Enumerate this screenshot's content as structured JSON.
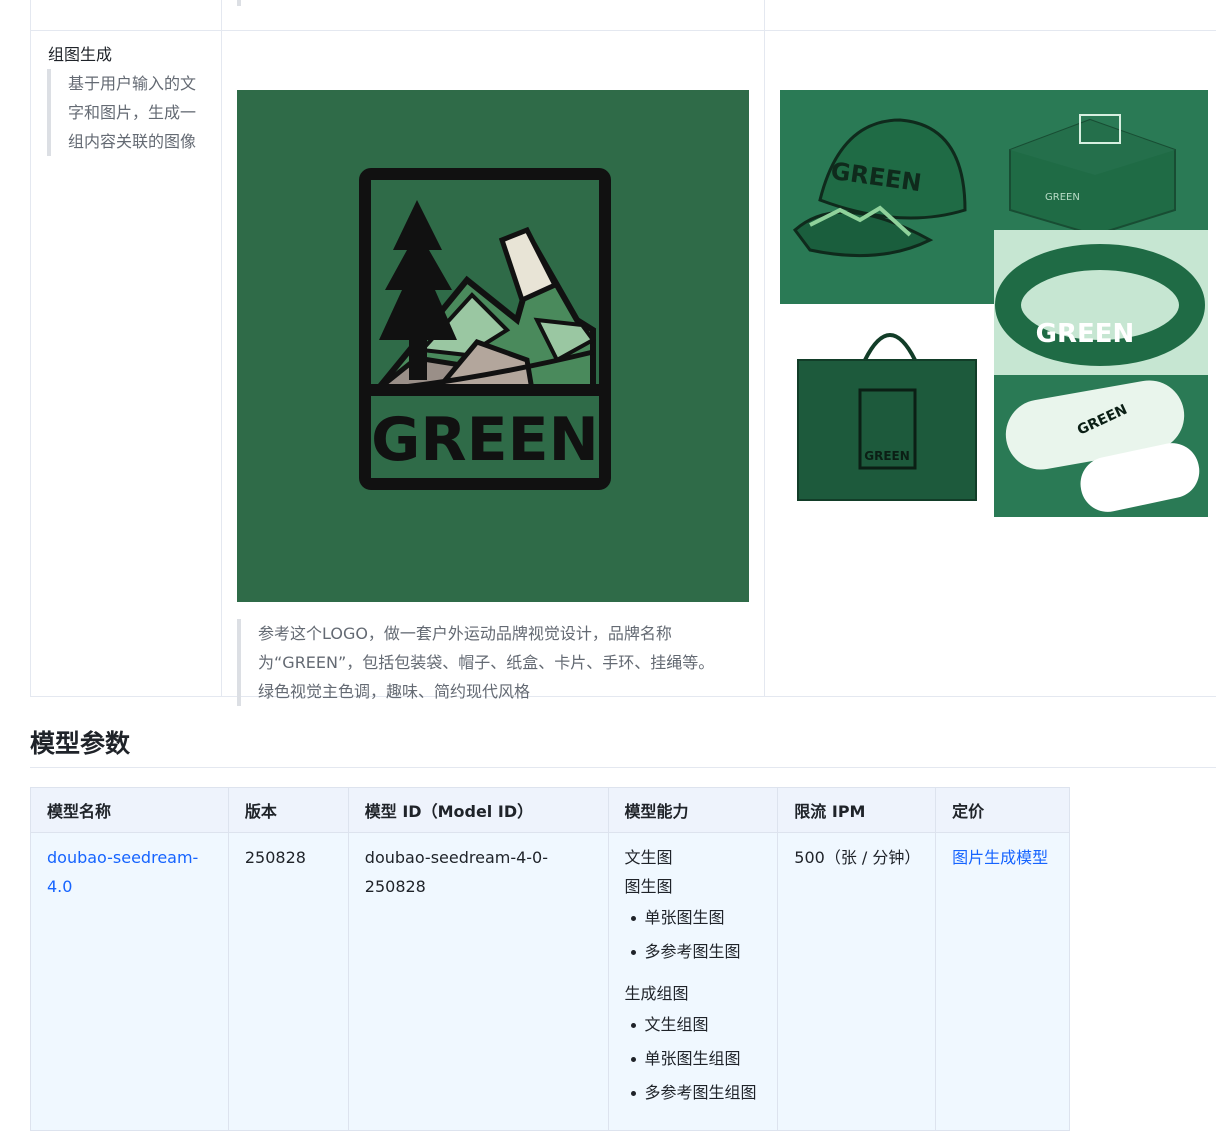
{
  "example": {
    "feature_title": "组图生成",
    "feature_description": "基于用户输入的文字和图片，生成一组内容关联的图像",
    "prompt": "参考这个LOGO，做一套户外运动品牌视觉设计，品牌名称为“GREEN”，包括包装袋、帽子、纸盒、卡片、手环、挂绳等。绿色视觉主色调，趣味、简约现代风格",
    "logo_text": "GREEN",
    "products": {
      "cap_text": "GREEN",
      "box_text": "GREEN",
      "band_text": "GREEN",
      "bag_text": "GREEN",
      "card_text": "GREEN"
    }
  },
  "section": {
    "title": "模型参数"
  },
  "params_table": {
    "headers": [
      "模型名称",
      "版本",
      "模型 ID（Model ID）",
      "模型能力",
      "限流 IPM",
      "定价"
    ],
    "row": {
      "model_name": "doubao-seedream-4.0",
      "version": "250828",
      "model_id": "doubao-seedream-4-0-250828",
      "capabilities": {
        "text_to_image": "文生图",
        "image_to_image": "图生图",
        "image_to_image_items": [
          "单张图生图",
          "多参考图生图"
        ],
        "group_generation": "生成组图",
        "group_items": [
          "文生组图",
          "单张图生组图",
          "多参考图生组图"
        ]
      },
      "rate_limit": "500（张 / 分钟）",
      "pricing": "图片生成模型"
    }
  },
  "colors": {
    "brand_green": "#2f6b48",
    "link": "#1664ff",
    "header_bg": "#eef3fc",
    "cell_bg": "#f0f8ff"
  }
}
